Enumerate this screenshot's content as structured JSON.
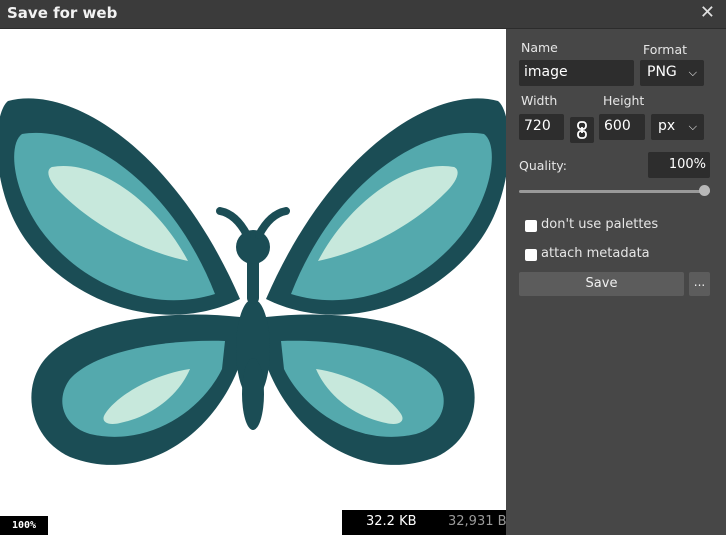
{
  "window": {
    "title": "Save for web",
    "close_icon": "close-icon"
  },
  "canvas": {
    "zoom": "100%",
    "size_kb": "32.2 KB",
    "size_bytes": "32,931 B"
  },
  "panel": {
    "name_label": "Name",
    "name_value": "image",
    "format_label": "Format",
    "format_value": "PNG",
    "width_label": "Width",
    "width_value": "720",
    "height_label": "Height",
    "height_value": "600",
    "unit_value": "px",
    "quality_label": "Quality:",
    "quality_value": "100%",
    "quality_level": 1.0,
    "palettes_label": "don't use palettes",
    "palettes_checked": false,
    "metadata_label": "attach metadata",
    "metadata_checked": false,
    "save_label": "Save",
    "more_label": "..."
  },
  "colors": {
    "wing_dark": "#1b4d55",
    "wing_mid": "#54a9ad",
    "wing_light": "#c7e8dc",
    "panel": "#474747",
    "field": "#2d2d2d"
  }
}
